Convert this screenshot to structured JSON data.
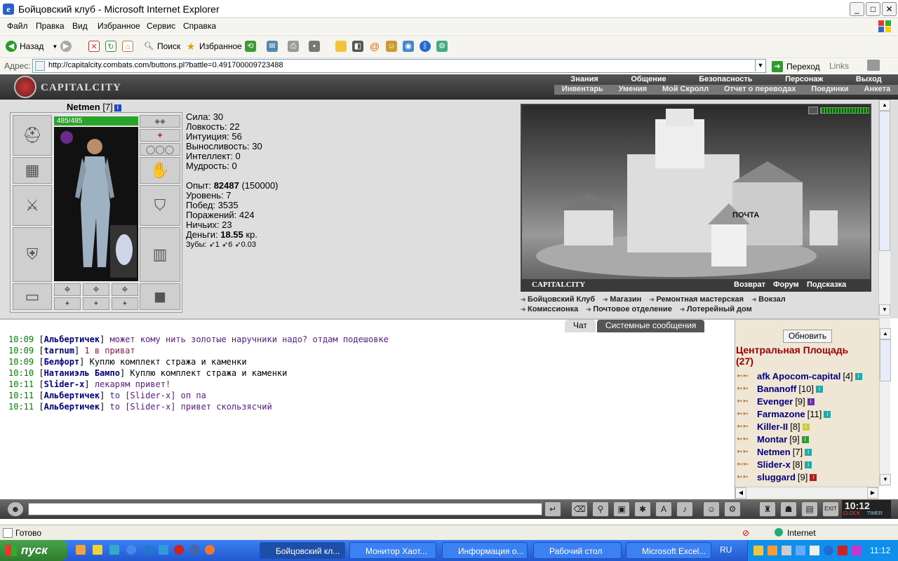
{
  "window": {
    "title": "Бойцовский клуб - Microsoft Internet Explorer",
    "min": "_",
    "max": "□",
    "close": "✕"
  },
  "menu": [
    "Файл",
    "Правка",
    "Вид",
    "Избранное",
    "Сервис",
    "Справка"
  ],
  "toolbar": {
    "back": "Назад",
    "search": "Поиск",
    "favorites": "Избранное"
  },
  "address": {
    "label": "Адрес:",
    "url": "http://capitalcity.combats.com/buttons.pl?battle=0.491700009723488",
    "go": "Переход",
    "links": "Links"
  },
  "game": {
    "city": "CAPITALCITY",
    "nav_top": [
      "Знания",
      "Общение",
      "Безопасность",
      "Персонаж",
      "Выход"
    ],
    "nav_bottom": [
      "Инвентарь",
      "Умения",
      "Мой Скролл",
      "Отчет о переводах",
      "Поединки",
      "Анкета"
    ],
    "character": {
      "name": "Netmen",
      "level": "[7]",
      "hp": "485/485"
    },
    "stats": [
      "Сила: 30",
      "Ловкость: 22",
      "Интуиция: 56",
      "Выносливость: 30",
      "Интеллект: 0",
      "Мудрость: 0"
    ],
    "exp": {
      "label": "Опыт:",
      "value": "82487",
      "next": "(150000)"
    },
    "details": [
      "Уровень: 7",
      "Побед: 3535",
      "Поражений: 424",
      "Ничьих: 23"
    ],
    "money": {
      "label": "Деньги:",
      "value": "18.55",
      "unit": "кр."
    },
    "teeth": "Зубы: ➶1 ➶6 ➶0.03",
    "scene": {
      "city": "CAPITALCITY",
      "links": [
        "Возврат",
        "Форум",
        "Подсказка"
      ],
      "sign": "ПОЧТА"
    },
    "places": [
      "Бойцовский Клуб",
      "Магазин",
      "Ремонтная мастерская",
      "Вокзал",
      "Комиссионка",
      "Почтовое отделение",
      "Лотерейный дом"
    ]
  },
  "chat": {
    "tabs": [
      "Чат",
      "Системные сообщения"
    ],
    "lines": [
      {
        "time": "10:09",
        "nick": "Альбертичек",
        "to": "",
        "text": "может кому нить золотые наручники надо? отдам подешовке",
        "color": "#5a1a8a"
      },
      {
        "time": "10:09",
        "nick": "tarnum",
        "to": "",
        "text": "1 в приват",
        "color": "#8a1a4a"
      },
      {
        "time": "10:09",
        "nick": "Белфорт",
        "to": "",
        "text": "Куплю комплект стража и каменки",
        "color": "#000000"
      },
      {
        "time": "10:10",
        "nick": "Натаниэль Бампо",
        "to": "",
        "text": "Куплю комплект стража и каменки",
        "color": "#000000"
      },
      {
        "time": "10:11",
        "nick": "Slider-x",
        "to": "",
        "text": "лекарям привет!",
        "color": "#5a1a8a"
      },
      {
        "time": "10:11",
        "nick": "Альбертичек",
        "to": "to [Slider-x]",
        "text": "оп па",
        "color": "#5a1a8a"
      },
      {
        "time": "10:11",
        "nick": "Альбертичек",
        "to": "to [Slider-x]",
        "text": "привет скользясчий",
        "color": "#5a1a8a"
      }
    ]
  },
  "online": {
    "refresh": "Обновить",
    "room": "Центральная Площадь",
    "count": "(27)",
    "users": [
      {
        "prefix": "afk",
        "name": "Apocom-capital",
        "level": "[4]",
        "color": "#2aa"
      },
      {
        "prefix": "",
        "name": "Bananoff",
        "level": "[10]",
        "color": "#2aa"
      },
      {
        "prefix": "",
        "name": "Evenger",
        "level": "[9]",
        "color": "#639"
      },
      {
        "prefix": "",
        "name": "Farmazone",
        "level": "[11]",
        "color": "#2aa"
      },
      {
        "prefix": "",
        "name": "Killer-II",
        "level": "[8]",
        "color": "#cc3"
      },
      {
        "prefix": "",
        "name": "Montar",
        "level": "[9]",
        "color": "#393"
      },
      {
        "prefix": "",
        "name": "Netmen",
        "level": "[7]",
        "color": "#2aa"
      },
      {
        "prefix": "",
        "name": "Slider-x",
        "level": "[8]",
        "color": "#2aa"
      },
      {
        "prefix": "",
        "name": "sluggard",
        "level": "[9]",
        "color": "#a22"
      }
    ]
  },
  "clock": {
    "time": "10:12",
    "clock_label": "CLOCK",
    "timer_label": "TIMER"
  },
  "status": {
    "text": "Готово",
    "zone": "Internet"
  },
  "taskbar": {
    "start": "пуск",
    "tasks": [
      "Бойцовский кл...",
      "Монитор Хаот...",
      "Информация о...",
      "Рабочий стол",
      "Microsoft Excel..."
    ],
    "lang": "RU",
    "time": "11:12"
  }
}
